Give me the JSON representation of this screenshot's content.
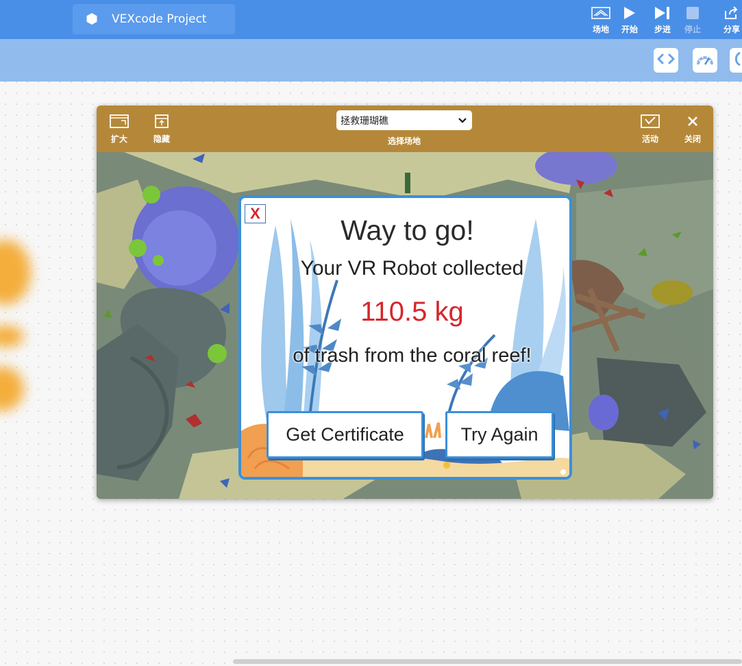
{
  "header": {
    "project_title": "VEXcode Project",
    "buttons": [
      {
        "label": "场地",
        "icon": "playground-icon"
      },
      {
        "label": "开始",
        "icon": "play-icon"
      },
      {
        "label": "步进",
        "icon": "step-icon"
      },
      {
        "label": "停止",
        "icon": "stop-icon",
        "disabled": true
      },
      {
        "label": "分享",
        "icon": "share-icon"
      }
    ]
  },
  "subbar": {
    "buttons": [
      {
        "icon": "code-view-icon"
      },
      {
        "icon": "dashboard-icon"
      },
      {
        "icon": "help-icon"
      }
    ]
  },
  "playground": {
    "expand_label": "扩大",
    "hide_label": "隐藏",
    "selected_field": "拯救珊瑚礁",
    "select_caption": "选择场地",
    "activity_label": "活动",
    "close_label": "关闭"
  },
  "dialog": {
    "close_label": "X",
    "title": "Way to go!",
    "line1": "Your VR Robot collected",
    "amount": "110.5 kg",
    "line2": "of trash from the coral reef!",
    "certificate_button": "Get Certificate",
    "try_again_button": "Try Again"
  },
  "colors": {
    "topbar": "#4a8fe7",
    "subbar": "#90bbec",
    "playground_bar": "#b58839",
    "dialog_border": "#3b8fd9",
    "amount": "#d6262b"
  }
}
